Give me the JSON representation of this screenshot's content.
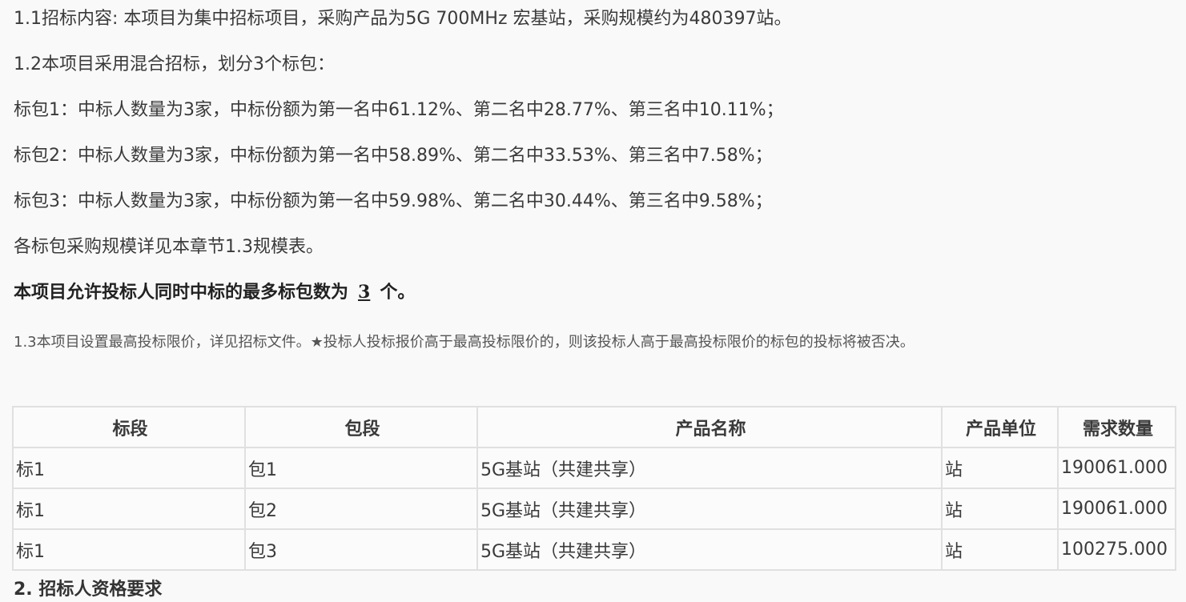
{
  "paragraphs": {
    "p1": "1.1招标内容: 本项目为集中招标项目，采购产品为5G 700MHz 宏基站，采购规模约为480397站。",
    "p2": "1.2本项目采用混合招标，划分3个标包：",
    "p3": "标包1：中标人数量为3家，中标份额为第一名中61.12%、第二名中28.77%、第三名中10.11%；",
    "p4": "标包2：中标人数量为3家，中标份额为第一名中58.89%、第二名中33.53%、第三名中7.58%；",
    "p5": "标包3：中标人数量为3家，中标份额为第一名中59.98%、第二名中30.44%、第三名中9.58%；",
    "p6": "各标包采购规模详见本章节1.3规模表。",
    "p7_prefix": "本项目允许投标人同时中标的最多标包数为",
    "p7_value": "3",
    "p7_suffix": "个。",
    "p8": "1.3本项目设置最高投标限价，详见招标文件。★投标人投标报价高于最高投标限价的，则该投标人高于最高投标限价的标包的投标将被否决。"
  },
  "table": {
    "headers": [
      "标段",
      "包段",
      "产品名称",
      "产品单位",
      "需求数量"
    ],
    "rows": [
      [
        "标1",
        "包1",
        "5G基站（共建共享）",
        "站",
        "190061.000"
      ],
      [
        "标1",
        "包2",
        "5G基站（共建共享）",
        "站",
        "190061.000"
      ],
      [
        "标1",
        "包3",
        "5G基站（共建共享）",
        "站",
        "100275.000"
      ]
    ]
  },
  "cut_heading": "2. 招标人资格要求"
}
